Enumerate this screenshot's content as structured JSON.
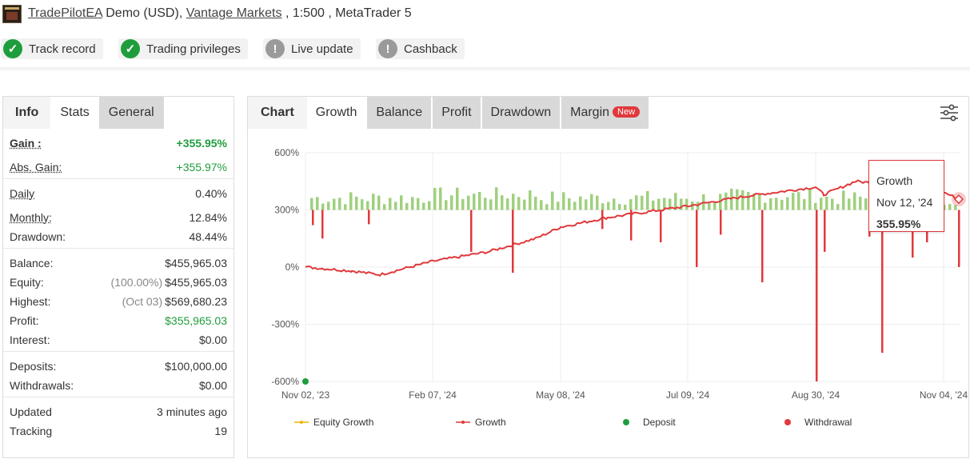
{
  "header": {
    "ea_name": "TradePilotEA",
    "account_type": "Demo (USD),",
    "broker": "Vantage Markets",
    "leverage_platform": ", 1:500 , MetaTrader 5"
  },
  "badges": [
    {
      "label": "Track record",
      "status": "verified"
    },
    {
      "label": "Trading privileges",
      "status": "verified"
    },
    {
      "label": "Live update",
      "status": "unverified"
    },
    {
      "label": "Cashback",
      "status": "unverified"
    }
  ],
  "left_tabs": [
    "Info",
    "Stats",
    "General"
  ],
  "stats": {
    "gain_label": "Gain :",
    "gain": "+355.95%",
    "abs_gain_label": "Abs. Gain:",
    "abs_gain": "+355.97%",
    "daily_label": "Daily",
    "daily": "0.40%",
    "monthly_label": "Monthly:",
    "monthly": "12.84%",
    "drawdown_label": "Drawdown:",
    "drawdown": "48.44%",
    "balance_label": "Balance:",
    "balance": "$455,965.03",
    "equity_label": "Equity:",
    "equity_pct": "(100.00%)",
    "equity": "$455,965.03",
    "highest_label": "Highest:",
    "highest_date": "(Oct 03)",
    "highest": "$569,680.23",
    "profit_label": "Profit:",
    "profit": "$355,965.03",
    "interest_label": "Interest:",
    "interest": "$0.00",
    "deposits_label": "Deposits:",
    "deposits": "$100,000.00",
    "withdrawals_label": "Withdrawals:",
    "withdrawals": "$0.00",
    "updated_label": "Updated",
    "updated": "3 minutes ago",
    "tracking_label": "Tracking",
    "tracking": "19"
  },
  "chart_tabs": {
    "label": "Chart",
    "tabs": [
      "Growth",
      "Balance",
      "Profit",
      "Drawdown",
      "Margin"
    ],
    "selected": "Growth",
    "new_badge": "New"
  },
  "tooltip": {
    "title": "Growth",
    "date": "Nov 12, '24",
    "value": "355.95%"
  },
  "colors": {
    "growth": "#e0393b",
    "equity": "#f0b400",
    "deposit": "#1f9d3d",
    "withdrawal": "#e0393b",
    "bars_pos": "#9fd07e",
    "bars_neg": "#e0393b"
  },
  "chart_data": {
    "type": "line",
    "y_ticks": [
      "600%",
      "300%",
      "0%",
      "-300%",
      "-600%"
    ],
    "ylim": [
      -600,
      600
    ],
    "x_ticks": [
      "Nov 02, '23",
      "Feb 07, '24",
      "May 08, '24",
      "Jul 09, '24",
      "Aug 30, '24",
      "Nov 04, '24"
    ],
    "legend": [
      "Equity Growth",
      "Growth",
      "Deposit",
      "Withdrawal"
    ],
    "series": [
      {
        "name": "Growth",
        "x": [
          "Nov 02, '23",
          "Dec 01, '23",
          "Jan 01, '24",
          "Feb 07, '24",
          "Mar 01, '24",
          "Apr 01, '24",
          "May 08, '24",
          "Jun 01, '24",
          "Jul 09, '24",
          "Aug 01, '24",
          "Aug 30, '24",
          "Sep 10, '24",
          "Oct 03, '24",
          "Nov 04, '24",
          "Nov 12, '24"
        ],
        "values": [
          0,
          -20,
          -40,
          30,
          80,
          150,
          210,
          260,
          320,
          370,
          420,
          380,
          450,
          410,
          356
        ]
      }
    ],
    "daily_bars_note": "positive daily gains ~+50..+200%, withdrawal spikes down to ~-480%",
    "deposit": {
      "x": "Nov 02, '23",
      "value": -600
    }
  }
}
